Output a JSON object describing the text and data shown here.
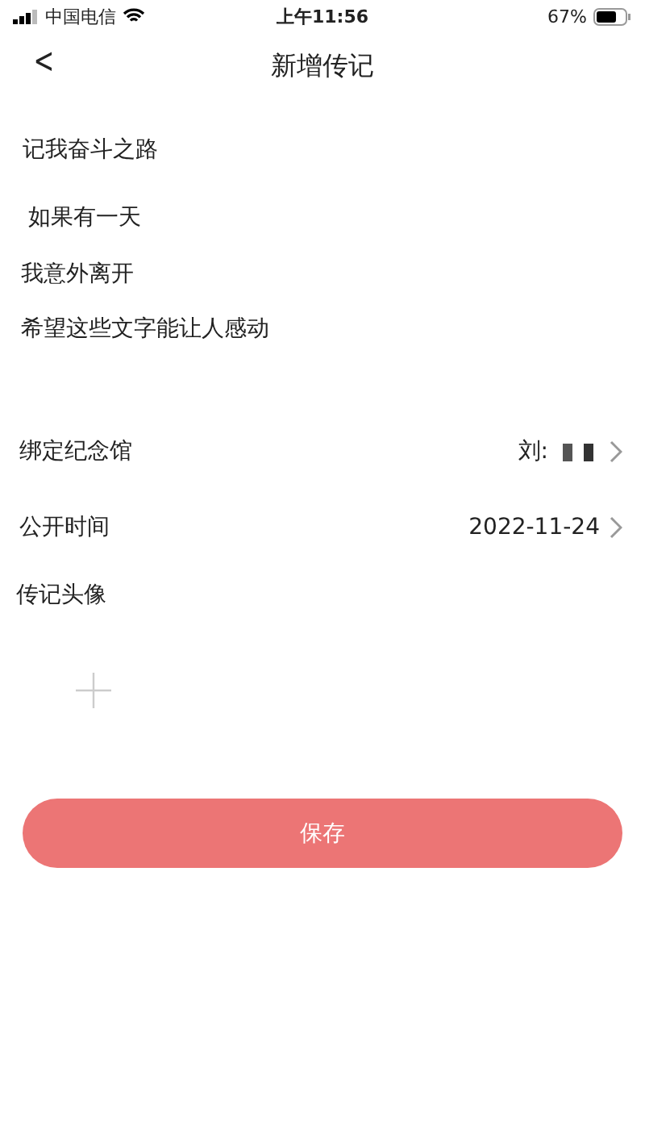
{
  "status_bar": {
    "carrier": "中国电信",
    "time": "上午11:56",
    "battery": "67%"
  },
  "nav": {
    "back": "<",
    "title": "新增传记"
  },
  "form": {
    "title_value": "记我奋斗之路",
    "content_lines": [
      " 如果有一天",
      "我意外离开",
      "希望这些文字能让人感动"
    ],
    "rows": [
      {
        "label": "绑定纪念馆",
        "value": "刘:",
        "redacted": true
      },
      {
        "label": "公开时间",
        "value": "2022-11-24",
        "redacted": false
      }
    ],
    "avatar_label": "传记头像"
  },
  "save_button": "保存"
}
